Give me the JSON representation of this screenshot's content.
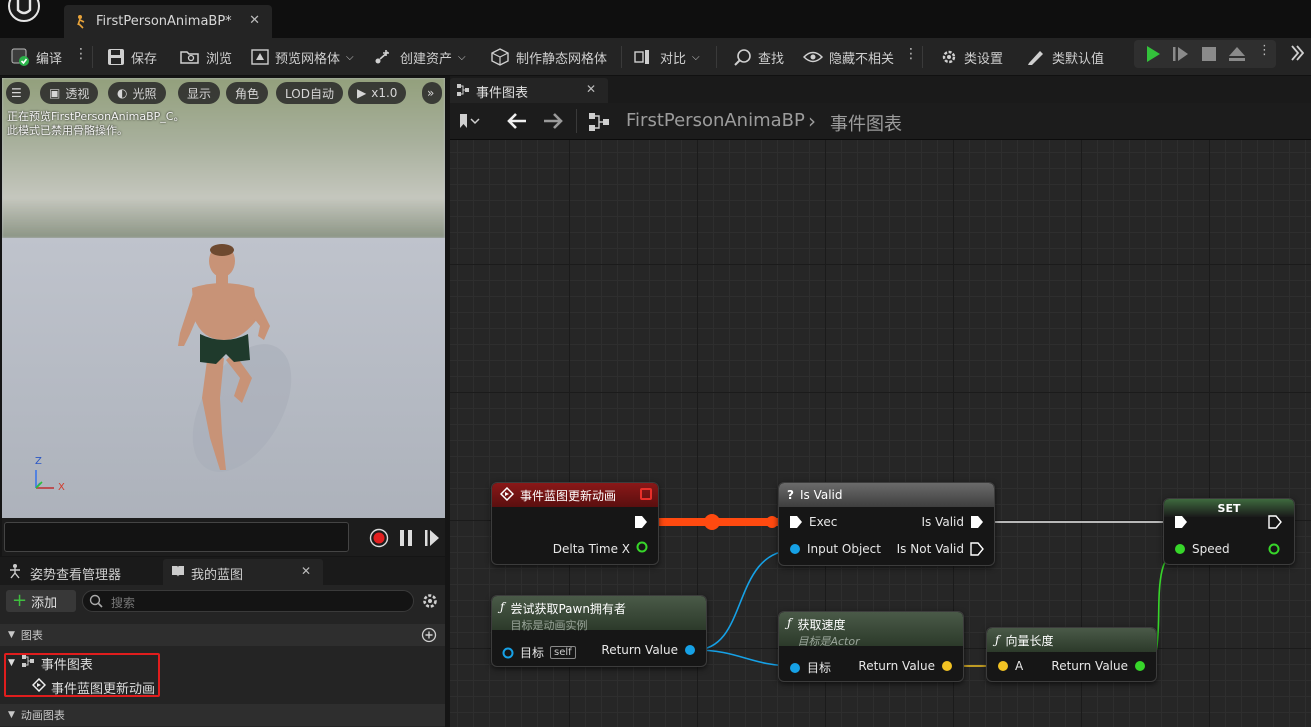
{
  "window": {
    "tab_title": "FirstPersonAnimaBP*",
    "close_symbol": "✕"
  },
  "toolbar": {
    "compile": "编译",
    "save": "保存",
    "browse": "浏览",
    "preview_mesh": "预览网格体",
    "create_asset": "创建资产",
    "make_static_mesh": "制作静态网格体",
    "diff": "对比",
    "find": "查找",
    "hide_unrelated": "隐藏不相关",
    "class_settings": "类设置",
    "class_defaults": "类默认值"
  },
  "viewport": {
    "buttons": {
      "perspective": "透视",
      "lit": "光照",
      "show": "显示",
      "character": "角色",
      "lod": "LOD自动",
      "speed": "x1.0"
    },
    "info_line1": "正在预览FirstPersonAnimaBP_C。",
    "info_line2": "此模式已禁用骨骼操作。",
    "axis_z": "Z",
    "axis_x": "X"
  },
  "left_panel": {
    "tab_pose": "姿势查看管理器",
    "tab_blueprint": "我的蓝图",
    "add_label": "添加",
    "search_placeholder": "搜索",
    "section_graphs": "图表",
    "item_event_graph": "事件图表",
    "item_update_anim": "事件蓝图更新动画",
    "section_anim_graphs": "动画图表"
  },
  "graph": {
    "tab_label": "事件图表",
    "breadcrumb_root": "FirstPersonAnimaBP",
    "breadcrumb_sep": "›",
    "breadcrumb_leaf": "事件图表",
    "nodes": {
      "event": {
        "title": "事件蓝图更新动画",
        "out_pin": "Delta Time X"
      },
      "is_valid": {
        "title": "Is Valid",
        "exec": "Exec",
        "input": "Input Object",
        "valid": "Is Valid",
        "not_valid": "Is Not Valid"
      },
      "set": {
        "title": "SET",
        "speed": "Speed"
      },
      "try_get_pawn": {
        "title": "尝试获取Pawn拥有者",
        "subtitle": "目标是动画实例",
        "target": "目标",
        "self": "self",
        "ret": "Return Value"
      },
      "get_velocity": {
        "title": "获取速度",
        "subtitle": "目标是Actor",
        "target": "目标",
        "ret": "Return Value"
      },
      "vector_length": {
        "title": "向量长度",
        "a": "A",
        "ret": "Return Value"
      }
    }
  },
  "colors": {
    "event_header": "#7a1414",
    "func_header": "#3a4a38",
    "exec_wire_active": "#ff4a10",
    "object_pin": "#16a1e6",
    "float_pin": "#37d62a",
    "vector_pin": "#f1c223",
    "highlight": "#e01d1d"
  }
}
